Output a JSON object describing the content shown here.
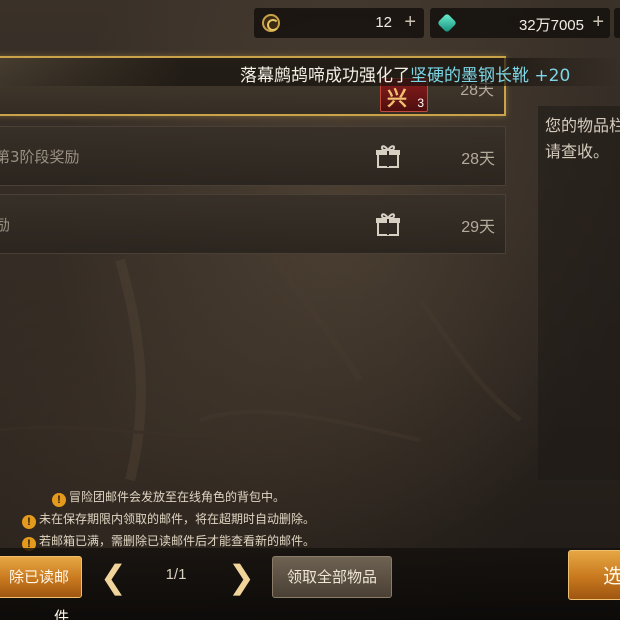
{
  "currency": {
    "gold_value": "12",
    "gem_value": "32万7005",
    "plus_label": "+"
  },
  "mails": [
    {
      "title": "",
      "days": "28天",
      "icon": "item-icon",
      "item_glyph": "兴",
      "item_count": "3"
    },
    {
      "title": "第3阶段奖励",
      "days": "28天",
      "icon": "gift-icon"
    },
    {
      "title": "励",
      "days": "29天",
      "icon": "gift-icon"
    }
  ],
  "notification": {
    "prefix": "落幕鹧鸪啼成功强化了",
    "item_name": "坚硬的墨钢长靴 +20"
  },
  "detail": {
    "line1": "您的物品栏",
    "line2": "请查收。"
  },
  "notices": [
    "冒险团邮件会发放至在线角色的背包中。",
    "未在保存期限内领取的邮件，将在超期时自动删除。",
    "若邮箱已满，需删除已读邮件后才能查看新的邮件。"
  ],
  "notice_icon": "!",
  "bottom": {
    "delete_read_label": "除已读邮件",
    "page_indicator": "1/1",
    "prev_arrow": "❮",
    "next_arrow": "❯",
    "claim_all_label": "领取全部物品",
    "select_label": "选"
  },
  "colors": {
    "accent_gold": "#c9a24a",
    "button_orange": "#c8781e",
    "item_name_cyan": "#7dd6e6",
    "warning_orange": "#e49a1c"
  }
}
